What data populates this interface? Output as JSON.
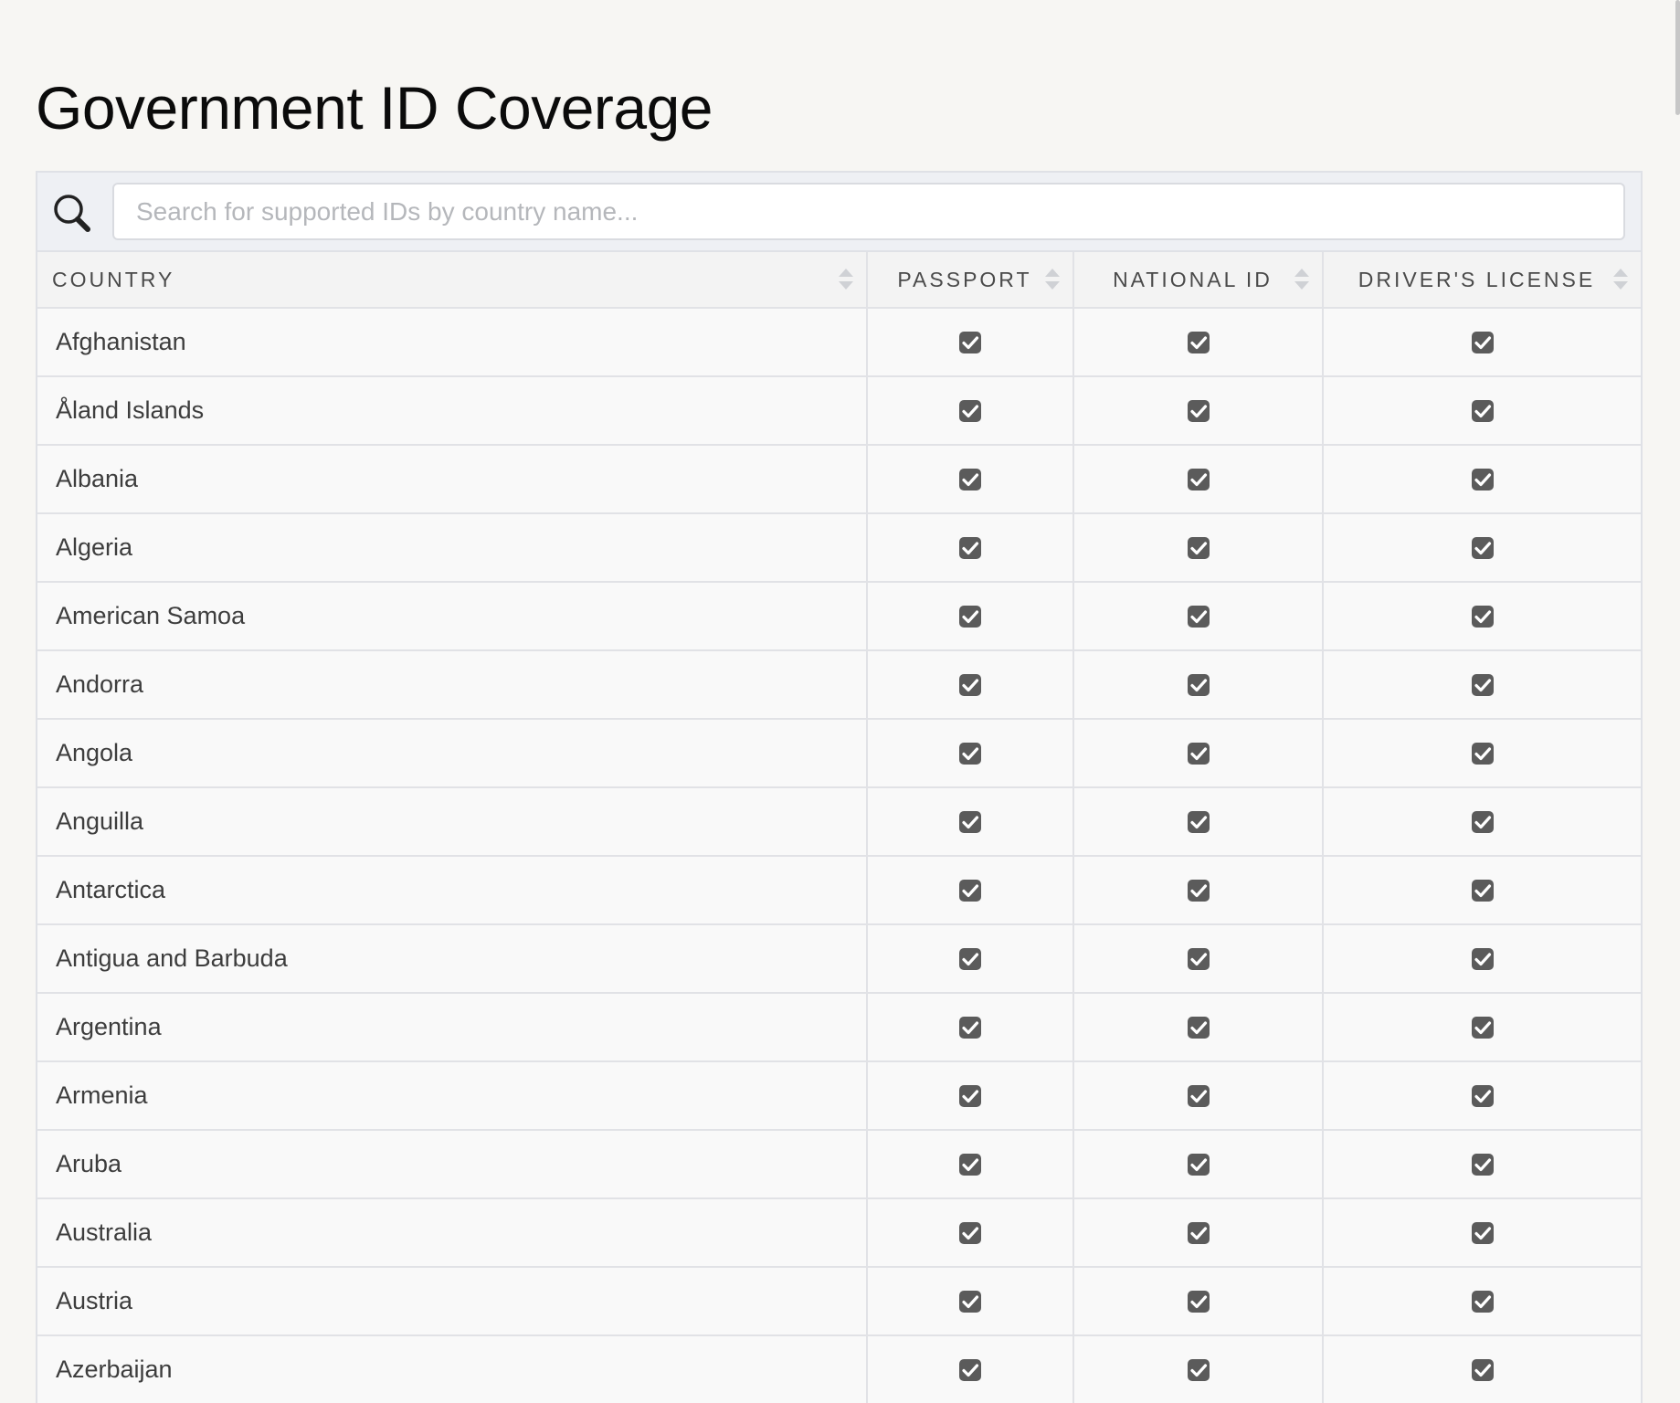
{
  "page": {
    "title": "Government ID Coverage"
  },
  "search": {
    "icon": "search-icon",
    "placeholder": "Search for supported IDs by country name...",
    "value": ""
  },
  "table": {
    "columns": [
      {
        "key": "country",
        "label": "COUNTRY",
        "sortable": true
      },
      {
        "key": "passport",
        "label": "PASSPORT",
        "sortable": true
      },
      {
        "key": "national_id",
        "label": "NATIONAL ID",
        "sortable": true
      },
      {
        "key": "drivers_license",
        "label": "DRIVER'S LICENSE",
        "sortable": true
      }
    ],
    "rows": [
      {
        "country": "Afghanistan",
        "passport": true,
        "national_id": true,
        "drivers_license": true
      },
      {
        "country": "Åland Islands",
        "passport": true,
        "national_id": true,
        "drivers_license": true
      },
      {
        "country": "Albania",
        "passport": true,
        "national_id": true,
        "drivers_license": true
      },
      {
        "country": "Algeria",
        "passport": true,
        "national_id": true,
        "drivers_license": true
      },
      {
        "country": "American Samoa",
        "passport": true,
        "national_id": true,
        "drivers_license": true
      },
      {
        "country": "Andorra",
        "passport": true,
        "national_id": true,
        "drivers_license": true
      },
      {
        "country": "Angola",
        "passport": true,
        "national_id": true,
        "drivers_license": true
      },
      {
        "country": "Anguilla",
        "passport": true,
        "national_id": true,
        "drivers_license": true
      },
      {
        "country": "Antarctica",
        "passport": true,
        "national_id": true,
        "drivers_license": true
      },
      {
        "country": "Antigua and Barbuda",
        "passport": true,
        "national_id": true,
        "drivers_license": true
      },
      {
        "country": "Argentina",
        "passport": true,
        "national_id": true,
        "drivers_license": true
      },
      {
        "country": "Armenia",
        "passport": true,
        "national_id": true,
        "drivers_license": true
      },
      {
        "country": "Aruba",
        "passport": true,
        "national_id": true,
        "drivers_license": true
      },
      {
        "country": "Australia",
        "passport": true,
        "national_id": true,
        "drivers_license": true
      },
      {
        "country": "Austria",
        "passport": true,
        "national_id": true,
        "drivers_license": true
      },
      {
        "country": "Azerbaijan",
        "passport": true,
        "national_id": true,
        "drivers_license": true
      }
    ]
  },
  "colors": {
    "page_background": "#f7f6f3",
    "checkbox_fill": "#5b5b5b",
    "border": "#e1e2e6"
  }
}
